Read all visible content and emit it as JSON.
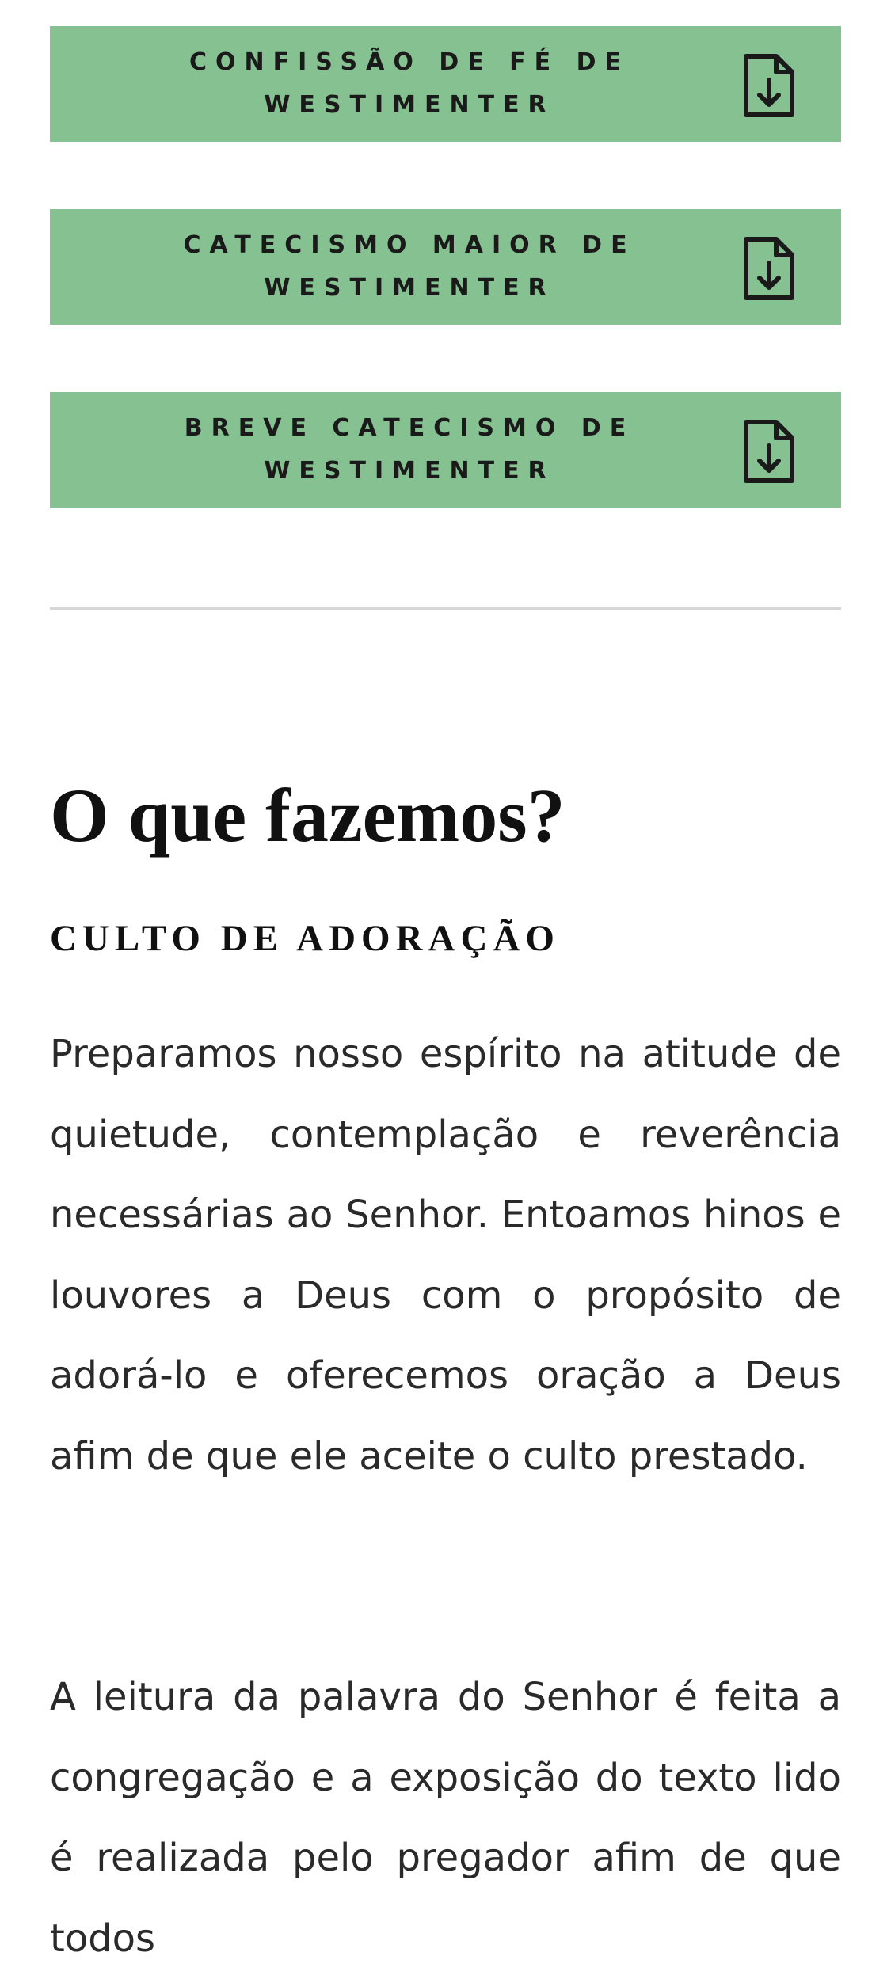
{
  "downloads": [
    {
      "label": "CONFISSÃO DE FÉ DE WESTIMENTER",
      "icon": "file-download-icon"
    },
    {
      "label": "CATECISMO MAIOR DE WESTIMENTER",
      "icon": "file-download-icon"
    },
    {
      "label": "BREVE CATECISMO DE WESTIMENTER",
      "icon": "file-download-icon"
    }
  ],
  "section": {
    "title": "O que fazemos?",
    "subtitle": "CULTO DE ADORAÇÃO",
    "paragraphs": [
      "Preparamos nosso espírito na atitude de quietude, contemplação e reverência necessárias ao Senhor. Entoamos hinos e louvores a Deus com o propósito de adorá-lo e oferecemos oração a Deus afim de que ele aceite o culto prestado.",
      "A leitura da palavra do Senhor é feita a congregação e a exposição do texto lido é realizada pelo pregador afim de que todos"
    ]
  },
  "colors": {
    "button_background": "#86c191",
    "button_text": "#1a1a1a",
    "divider": "#d6d6d6"
  }
}
